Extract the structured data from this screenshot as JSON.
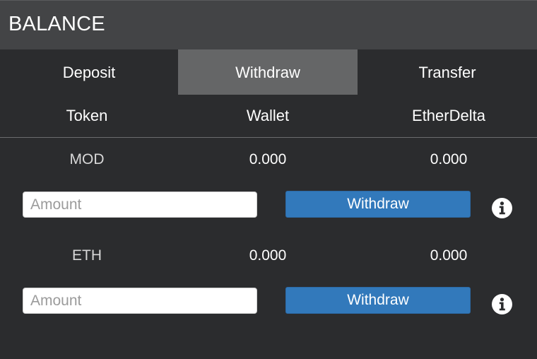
{
  "header": {
    "title": "BALANCE"
  },
  "tabs": [
    {
      "label": "Deposit",
      "active": false
    },
    {
      "label": "Withdraw",
      "active": true
    },
    {
      "label": "Transfer",
      "active": false
    }
  ],
  "columns": [
    "Token",
    "Wallet",
    "EtherDelta"
  ],
  "rows": [
    {
      "token": "MOD",
      "wallet": "0.000",
      "etherdelta": "0.000",
      "amount_value": "",
      "amount_placeholder": "Amount",
      "action_label": "Withdraw",
      "info_icon": "info-circle-icon"
    },
    {
      "token": "ETH",
      "wallet": "0.000",
      "etherdelta": "0.000",
      "amount_value": "",
      "amount_placeholder": "Amount",
      "action_label": "Withdraw",
      "info_icon": "info-circle-icon"
    }
  ],
  "colors": {
    "background": "#2b2c2e",
    "header": "#434446",
    "active_tab": "#656667",
    "button": "#3279bb"
  }
}
